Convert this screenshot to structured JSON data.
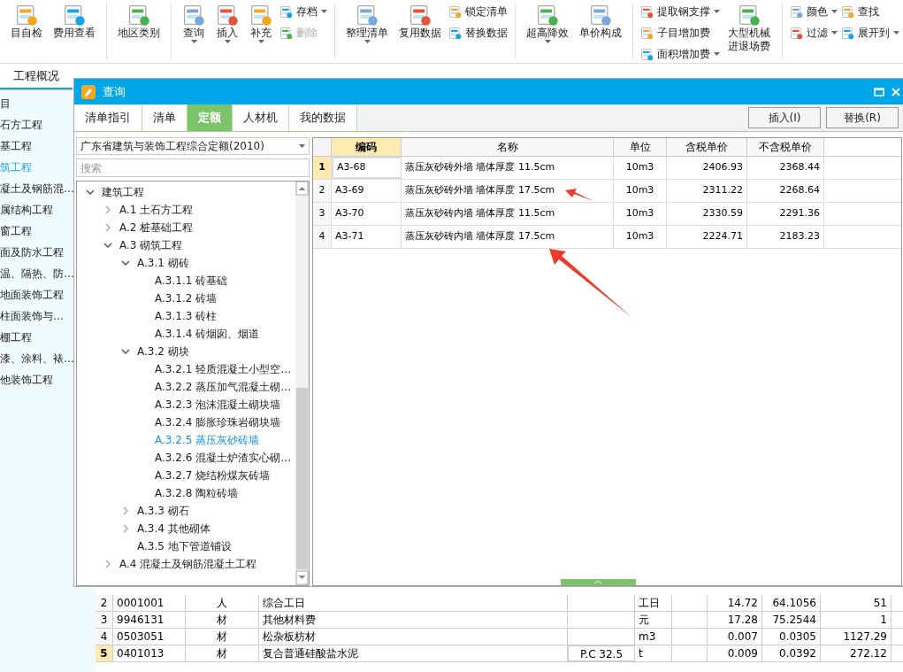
{
  "toolbar": [
    {
      "items": [
        {
          "kind": "large",
          "label": "目自检",
          "dropdown": false
        },
        {
          "kind": "large",
          "label": "费用查看",
          "dropdown": false
        }
      ]
    },
    {
      "items": [
        {
          "kind": "large",
          "label": "地区类别",
          "dropdown": false
        }
      ]
    },
    {
      "items": [
        {
          "kind": "large",
          "label": "查询",
          "dropdown": true
        },
        {
          "kind": "large",
          "label": "插入",
          "dropdown": true
        },
        {
          "kind": "large",
          "label": "补充",
          "dropdown": true
        },
        {
          "kind": "stack",
          "children": [
            {
              "label": "存档",
              "dropdown": true,
              "disabled": false
            },
            {
              "label": "删除",
              "dropdown": false,
              "disabled": true
            }
          ]
        }
      ]
    },
    {
      "items": [
        {
          "kind": "large",
          "label": "整理清单",
          "dropdown": true
        },
        {
          "kind": "large",
          "label": "复用数据",
          "dropdown": false
        },
        {
          "kind": "stack",
          "children": [
            {
              "label": "锁定清单",
              "dropdown": false,
              "disabled": false
            },
            {
              "label": "替换数据",
              "dropdown": false,
              "disabled": false
            }
          ]
        }
      ]
    },
    {
      "items": [
        {
          "kind": "large",
          "label": "超高降效",
          "dropdown": true
        },
        {
          "kind": "large",
          "label": "单价构成",
          "dropdown": false
        }
      ]
    },
    {
      "items": [
        {
          "kind": "stack",
          "children": [
            {
              "label": "提取钢支撑",
              "dropdown": true,
              "disabled": false
            },
            {
              "label": "子目增加费",
              "dropdown": false,
              "disabled": false
            },
            {
              "label": "面积增加费",
              "dropdown": true,
              "disabled": false
            }
          ]
        },
        {
          "kind": "large",
          "label": "大型机械进退场费",
          "dropdown": false
        }
      ]
    },
    {
      "items": [
        {
          "kind": "stack",
          "children": [
            {
              "label": "颜色",
              "dropdown": true,
              "disabled": false
            },
            {
              "label": "过滤",
              "dropdown": true,
              "disabled": false
            }
          ]
        },
        {
          "kind": "stack",
          "children": [
            {
              "label": "查找",
              "dropdown": false,
              "disabled": false
            },
            {
              "label": "展开到",
              "dropdown": true,
              "disabled": false
            }
          ]
        }
      ]
    }
  ],
  "doc_tabs": [
    {
      "label": "工程概况",
      "selected": true
    }
  ],
  "sidebar": {
    "items": [
      {
        "label": "目",
        "selected": false
      },
      {
        "label": "石方工程",
        "selected": false
      },
      {
        "label": "基工程",
        "selected": false
      },
      {
        "label": "筑工程",
        "selected": true
      },
      {
        "label": "凝土及钢筋混…",
        "selected": false
      },
      {
        "label": "属结构工程",
        "selected": false
      },
      {
        "label": "窗工程",
        "selected": false
      },
      {
        "label": "面及防水工程",
        "selected": false
      },
      {
        "label": "温、隔热、防…",
        "selected": false
      },
      {
        "label": "地面装饰工程",
        "selected": false
      },
      {
        "label": "柱面装饰与…",
        "selected": false
      },
      {
        "label": "棚工程",
        "selected": false
      },
      {
        "label": "漆、涂料、裱…",
        "selected": false
      },
      {
        "label": "他装饰工程",
        "selected": false
      }
    ]
  },
  "dialog": {
    "title": "查询",
    "tabs": [
      {
        "label": "清单指引",
        "selected": false
      },
      {
        "label": "清单",
        "selected": false
      },
      {
        "label": "定额",
        "selected": true
      },
      {
        "label": "人材机",
        "selected": false
      },
      {
        "label": "我的数据",
        "selected": false
      }
    ],
    "buttons": [
      "插入(I)",
      "替换(R)"
    ],
    "library": "广东省建筑与装饰工程综合定额(2010)",
    "search": {
      "placeholder": "搜索"
    },
    "tree": [
      {
        "label": "建筑工程",
        "expanded": true,
        "selected": false,
        "children": [
          {
            "label": "A.1 土石方工程",
            "expanded": false,
            "selected": false
          },
          {
            "label": "A.2 桩基础工程",
            "expanded": false,
            "selected": false
          },
          {
            "label": "A.3 砌筑工程",
            "expanded": true,
            "selected": false,
            "children": [
              {
                "label": "A.3.1 砌砖",
                "expanded": true,
                "selected": false,
                "children": [
                  {
                    "label": "A.3.1.1 砖基础",
                    "selected": false
                  },
                  {
                    "label": "A.3.1.2 砖墙",
                    "selected": false
                  },
                  {
                    "label": "A.3.1.3 砖柱",
                    "selected": false
                  },
                  {
                    "label": "A.3.1.4 砖烟囱、烟道",
                    "selected": false
                  }
                ]
              },
              {
                "label": "A.3.2 砌块",
                "expanded": true,
                "selected": false,
                "children": [
                  {
                    "label": "A.3.2.1 轻质混凝土小型空…",
                    "selected": false
                  },
                  {
                    "label": "A.3.2.2 蒸压加气混凝土砌…",
                    "selected": false
                  },
                  {
                    "label": "A.3.2.3 泡沫混凝土砌块墙",
                    "selected": false
                  },
                  {
                    "label": "A.3.2.4 膨胀珍珠岩砌块墙",
                    "selected": false
                  },
                  {
                    "label": "A.3.2.5 蒸压灰砂砖墙",
                    "selected": true
                  },
                  {
                    "label": "A.3.2.6 混凝土炉渣实心砌…",
                    "selected": false
                  },
                  {
                    "label": "A.3.2.7 烧结粉煤灰砖墙",
                    "selected": false
                  },
                  {
                    "label": "A.3.2.8 陶粒砖墙",
                    "selected": false
                  }
                ]
              },
              {
                "label": "A.3.3 砌石",
                "expanded": false,
                "selected": false
              },
              {
                "label": "A.3.4 其他砌体",
                "expanded": false,
                "selected": false
              },
              {
                "label": "A.3.5 地下管道铺设",
                "selected": false
              }
            ]
          },
          {
            "label": "A.4 混凝土及钢筋混凝土工程",
            "expanded": false,
            "selected": false
          }
        ]
      }
    ],
    "grid": {
      "columns": [
        "编码",
        "名称",
        "单位",
        "含税单价",
        "不含税单价"
      ],
      "rows": [
        {
          "index": "1",
          "selected": true,
          "cells": [
            "A3-68",
            "蒸压灰砂砖外墙 墙体厚度 11.5cm",
            "10m3",
            "2406.93",
            "2368.44"
          ]
        },
        {
          "index": "2",
          "selected": false,
          "cells": [
            "A3-69",
            "蒸压灰砂砖外墙 墙体厚度 17.5cm",
            "10m3",
            "2311.22",
            "2268.64"
          ]
        },
        {
          "index": "3",
          "selected": false,
          "cells": [
            "A3-70",
            "蒸压灰砂砖内墙 墙体厚度 11.5cm",
            "10m3",
            "2330.59",
            "2291.36"
          ]
        },
        {
          "index": "4",
          "selected": false,
          "cells": [
            "A3-71",
            "蒸压灰砂砖内墙 墙体厚度 17.5cm",
            "10m3",
            "2224.71",
            "2183.23"
          ]
        }
      ]
    }
  },
  "materials": {
    "rows": [
      {
        "index": "2",
        "selected": false,
        "cells": [
          "0001001",
          "人",
          "综合工日",
          "",
          "工日",
          "",
          "14.72",
          "64.1056",
          "51"
        ]
      },
      {
        "index": "3",
        "selected": false,
        "cells": [
          "9946131",
          "材",
          "其他材料费",
          "",
          "元",
          "",
          "17.28",
          "75.2544",
          "1"
        ]
      },
      {
        "index": "4",
        "selected": false,
        "cells": [
          "0503051",
          "材",
          "松杂板枋材",
          "",
          "m3",
          "",
          "0.007",
          "0.0305",
          "1127.29"
        ]
      },
      {
        "index": "5",
        "selected": true,
        "cells": [
          "0401013",
          "材",
          "复合普通硅酸盐水泥",
          "P.C 32.5",
          "t",
          "",
          "0.009",
          "0.0392",
          "272.12"
        ]
      }
    ]
  }
}
